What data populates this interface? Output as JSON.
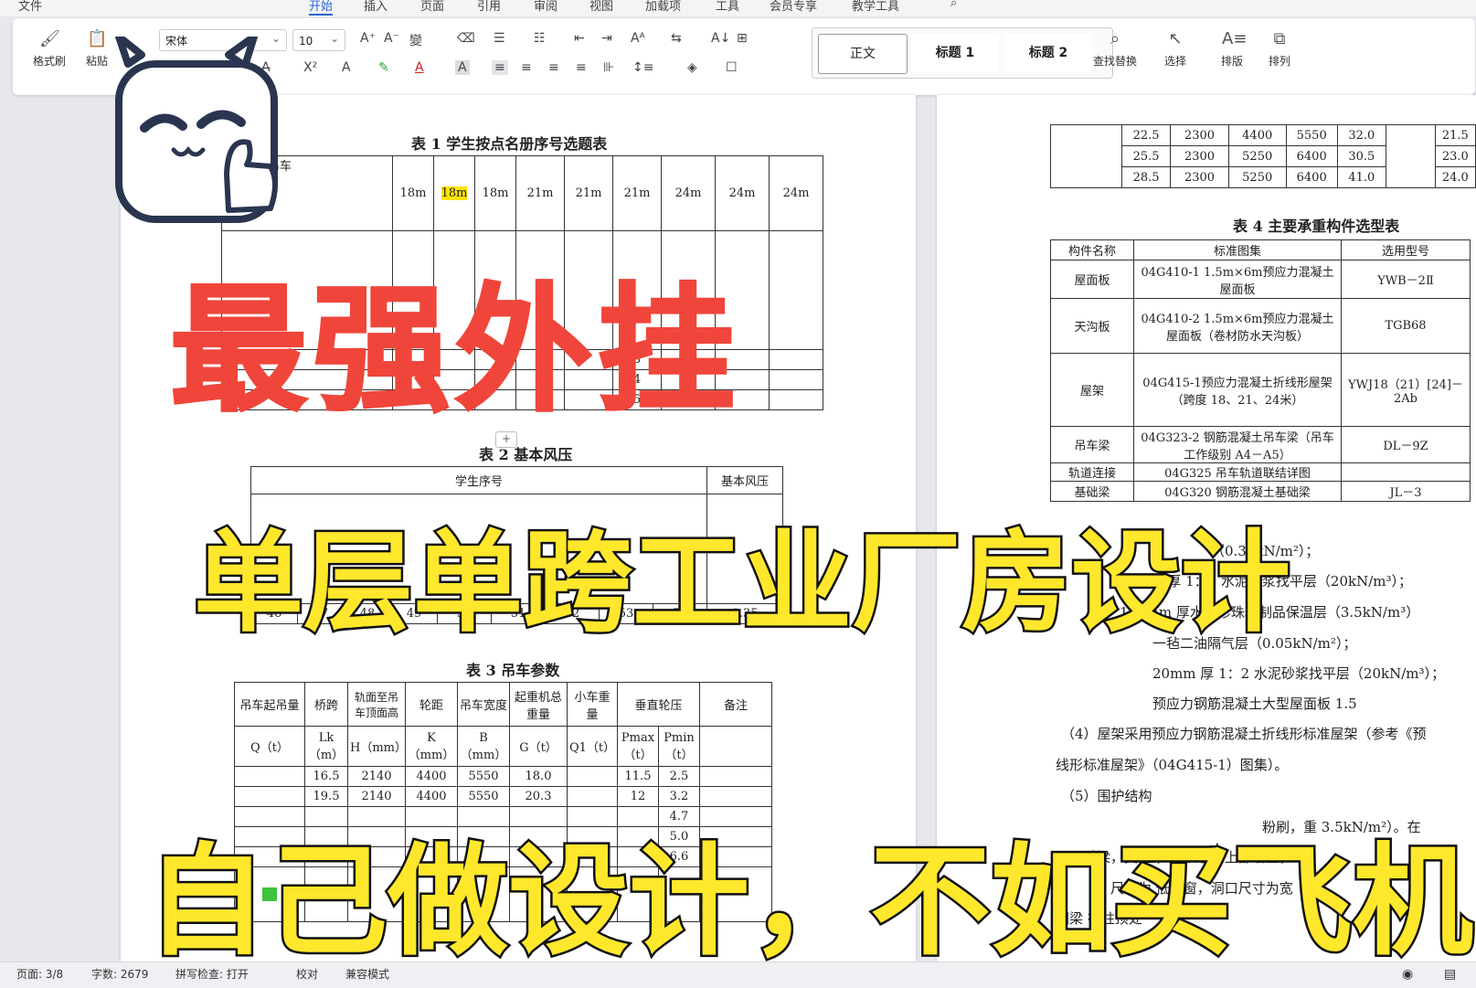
{
  "menu": [
    "文件",
    "开始",
    "插入",
    "页面",
    "引用",
    "审阅",
    "视图",
    "加载项",
    "工具",
    "会员专享",
    "教学工具"
  ],
  "ribbon": {
    "format_painter": "格式刷",
    "paste": "粘贴",
    "font_name": "宋体",
    "font_size": "10",
    "styles": [
      "正文",
      "标题 1",
      "标题 2"
    ],
    "find_replace": "查找替换",
    "select": "选择",
    "layout": "排版",
    "arrange": "排列"
  },
  "page1": {
    "table1_caption": "表 1  学生按点名册序号选题表",
    "table1_corner": "吊车",
    "table1_spans": [
      "18m",
      "18m",
      "18m",
      "21m",
      "21m",
      "21m",
      "24m",
      "24m",
      "24m"
    ],
    "table1_partial": [
      [
        "3",
        "4"
      ],
      [
        "4",
        "3"
      ],
      [
        "5",
        "2"
      ]
    ],
    "table2_caption": "表 2  基本风压",
    "table2_header": [
      "学生序号",
      "基本风压"
    ],
    "table2_row": [
      "46",
      "47",
      "48",
      "49",
      "50",
      "51",
      "52",
      "53",
      "54",
      "0.35"
    ],
    "table3_caption": "表 3  吊车参数",
    "table3_head1": [
      "吊车起吊量",
      "桥跨",
      "轨面至吊车顶面高",
      "轮距",
      "吊车宽度",
      "起重机总重量",
      "小车重量",
      "垂直轮压",
      "备注"
    ],
    "table3_head2": [
      "Q（t）",
      "Lk（m）",
      "H（mm）",
      "K（mm）",
      "B（mm）",
      "G（t）",
      "Q1（t）",
      "Pmax（t）",
      "Pmin（t）"
    ],
    "table3_rows": [
      [
        "16.5",
        "2140",
        "4400",
        "5550",
        "18.0",
        "11.5",
        "2.5"
      ],
      [
        "19.5",
        "2140",
        "4400",
        "5550",
        "20.3",
        "12",
        "3.2"
      ]
    ],
    "table3_pmin_extra": [
      "4.7",
      "5.0",
      "6.6"
    ]
  },
  "page2": {
    "top_rows": [
      [
        "22.5",
        "2300",
        "4400",
        "5550",
        "32.0",
        "21.5"
      ],
      [
        "25.5",
        "2300",
        "5250",
        "6400",
        "30.5",
        "23.0"
      ],
      [
        "28.5",
        "2300",
        "5250",
        "6400",
        "41.0",
        "24.0"
      ]
    ],
    "table4_caption": "表 4 主要承重构件选型表",
    "table4_header": [
      "构件名称",
      "标准图集",
      "选用型号"
    ],
    "table4_rows": [
      [
        "屋面板",
        "04G410-1 1.5m×6m预应力混凝土屋面板",
        "YWB－2Ⅱ"
      ],
      [
        "天沟板",
        "04G410-2 1.5m×6m预应力混凝土屋面板（卷材防水天沟板）",
        "TGB68"
      ],
      [
        "屋架",
        "04G415-1预应力混凝土折线形屋架（跨度 18、21、24米）",
        "YWJ18（21）[24]－2Ab"
      ],
      [
        "吊车梁",
        "04G323-2 钢筋混凝土吊车梁（吊车工作级别 A4－A5）",
        "DL－9Z"
      ],
      [
        "轨道连接",
        "04G325 吊车轨道联结详图",
        ""
      ],
      [
        "基础梁",
        "04G320 钢筋混凝土基础梁",
        "JL－3"
      ]
    ],
    "lines": [
      "（0.35kN/m²）；",
      "20mm 厚 1：3 水泥砂浆找平层（20kN/m³）；",
      "150mm 厚水泥珍珠岩制品保温层（3.5kN/m³）",
      "一毡二油隔气层（0.05kN/m²）；",
      "20mm 厚 1：2 水泥砂浆找平层（20kN/m³）；",
      "预应力钢筋混凝土大型屋面板   1.5",
      "（4）屋架采用预应力钢筋混凝土折线形标准屋架（参考《预",
      "线形标准屋架》（04G415-1）图集）。",
      "（5）围护结构",
      "粉刷，重 3.5kN/m²）。在",
      "系梁，支          上，用以承受上部墙重，",
      "尺寸为            低侧窗，洞口尺寸为宽",
      "圈梁      在柱顶处"
    ]
  },
  "overlay": {
    "line1": "最强外挂",
    "line2": "单层单跨工业厂房设计",
    "line3": "自己做设计，不如买飞机"
  },
  "status": {
    "page": "页面: 3/8",
    "words": "字数: 2679",
    "spell": "拼写检查: 打开",
    "proof": "校对",
    "compat": "兼容模式"
  },
  "colors": {
    "red_title": "#f0453a",
    "yellow_text": "#ffe72c",
    "accent": "#2b63d9"
  }
}
